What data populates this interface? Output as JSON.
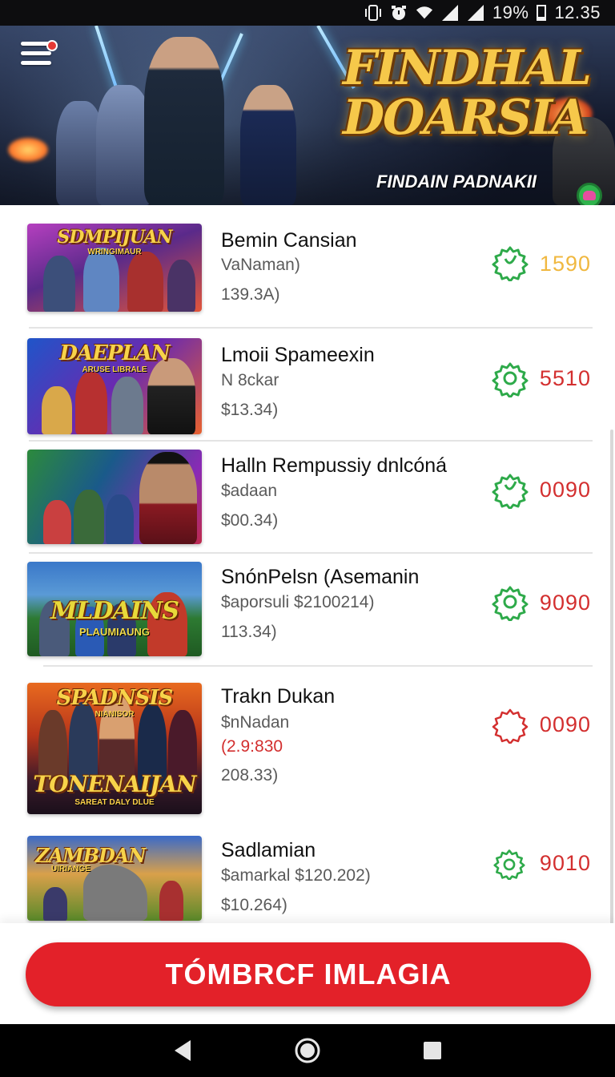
{
  "status_bar": {
    "battery_percent": "19%",
    "time": "12.35",
    "icons": [
      "vibrate-icon",
      "alarm-icon",
      "wifi-icon",
      "signal-icon",
      "signal-icon-2",
      "battery-icon"
    ]
  },
  "banner": {
    "title": "FINDHAL DOARSIA",
    "subtitle": "FINDAIN PADNAKII",
    "menu_icon": "hamburger-menu-icon",
    "notification_dot": true
  },
  "thumbnails": [
    {
      "title": "SDMPIJUAN",
      "sub": "WRINGIMAUR"
    },
    {
      "title": "DAEPLAN",
      "sub": "ARUSE LIBRALE"
    },
    {
      "title": "",
      "sub": ""
    },
    {
      "title": "MLDAINS",
      "sub": "PLAUMIAUNG"
    },
    {
      "title": "SPADNSIS",
      "sub": "NIANISOR",
      "title2": "TONENAIJAN",
      "sub2": "SAREAT DALY DLUE"
    },
    {
      "title": "ZAMBDAN",
      "sub": "UIRIANGE"
    }
  ],
  "list": [
    {
      "name": "Bemin Cansian",
      "line1": "VaNaman)",
      "line2": "",
      "line3": "139.3A)",
      "value": "1590",
      "value_color": "#f0b840",
      "icon": "settings-gear-icon",
      "icon_color": "#2eaa4a"
    },
    {
      "name": "Lmoii Spameexin",
      "line1": "N 8ckar",
      "line2": "",
      "line3": "$13.34)",
      "value": "5510",
      "value_color": "#d32f2f",
      "icon": "settings-gear-icon",
      "icon_color": "#2eaa4a"
    },
    {
      "name": "Halln  Rempussiy dnlcóná",
      "line1": "$adaan",
      "line2": "",
      "line3": "$00.34)",
      "value": "0090",
      "value_color": "#d32f2f",
      "icon": "settings-gear-icon",
      "icon_color": "#2eaa4a"
    },
    {
      "name": "SnónPelsn (Asemanin",
      "line1": "$aporsuli  $2100214)",
      "line2": "",
      "line3": "113.34)",
      "value": "9090",
      "value_color": "#d32f2f",
      "icon": "settings-gear-icon",
      "icon_color": "#2eaa4a"
    },
    {
      "name": "Trakn Dukan",
      "line1": "$nNadan",
      "line2": "(2.9:830",
      "line3": "208.33)",
      "value": "0090",
      "value_color": "#d32f2f",
      "icon": "settings-gear-outline-icon",
      "icon_color": "#d32f2f"
    },
    {
      "name": "Sadlamian",
      "line1": "$amarkal  $120.202)",
      "line2": "",
      "line3": "$10.264)",
      "value": "9010",
      "value_color": "#d32f2f",
      "icon": "settings-gear-icon",
      "icon_color": "#2eaa4a"
    }
  ],
  "cta": {
    "label": "TÓMBRCF IMLAGIA"
  },
  "nav": {
    "back": "back-icon",
    "home": "home-icon",
    "recents": "recents-icon"
  }
}
